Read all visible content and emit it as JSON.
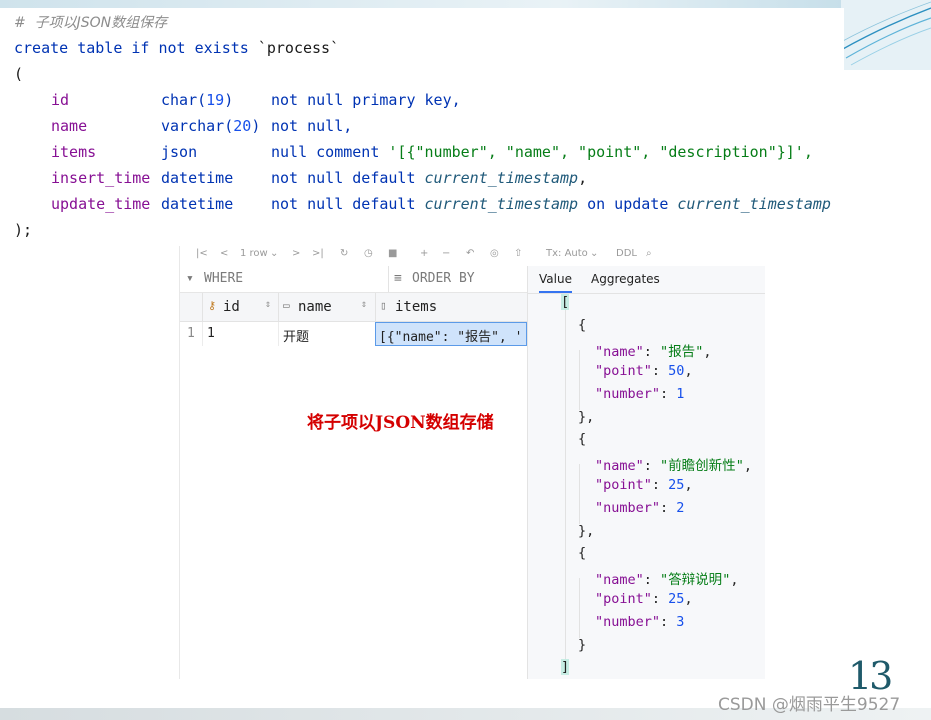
{
  "code": {
    "comment": "#  子项以JSON数组保存",
    "line1": {
      "kw": "create table if not exists",
      "name": "`process`"
    },
    "open": "(",
    "columns": [
      {
        "name": "id",
        "type": "char(",
        "arg": "19",
        "tail": ")",
        "constraint": "not null primary key,"
      },
      {
        "name": "name",
        "type": "varchar(",
        "arg": "20",
        "tail": ")",
        "constraint": "not null,"
      },
      {
        "name": "items",
        "type": "json",
        "arg": "",
        "tail": "",
        "constraint": "null comment",
        "comment_text": "'[{\"number\", \"name\", \"point\", \"description\"}]',"
      },
      {
        "name": "insert_time",
        "type": "datetime",
        "constraint": "not null default",
        "fn": "current_timestamp",
        "after": ","
      },
      {
        "name": "update_time",
        "type": "datetime",
        "constraint": "not null default",
        "fn": "current_timestamp",
        "mid": "on update",
        "fn2": "current_timestamp"
      }
    ],
    "close": ");"
  },
  "toolbar": {
    "rows": "1 row",
    "tx": "Tx: Auto",
    "ddl": "DDL"
  },
  "filter": {
    "where": "WHERE",
    "order_by": "ORDER BY"
  },
  "grid": {
    "headers": [
      "id",
      "name",
      "items"
    ],
    "row": {
      "num": "1",
      "id": "1",
      "name": "开题",
      "items": "[{\"name\": \"报告\", '"
    }
  },
  "note": "将子项以JSON数组存储",
  "value_pane": {
    "tabs": [
      "Value",
      "Aggregates"
    ],
    "json": [
      {
        "name": "报告",
        "point": "50",
        "number": "1"
      },
      {
        "name": "前瞻创新性",
        "point": "25",
        "number": "2"
      },
      {
        "name": "答辩说明",
        "point": "25",
        "number": "3"
      }
    ]
  },
  "page_number": "13",
  "watermark": "CSDN @烟雨平生9527"
}
